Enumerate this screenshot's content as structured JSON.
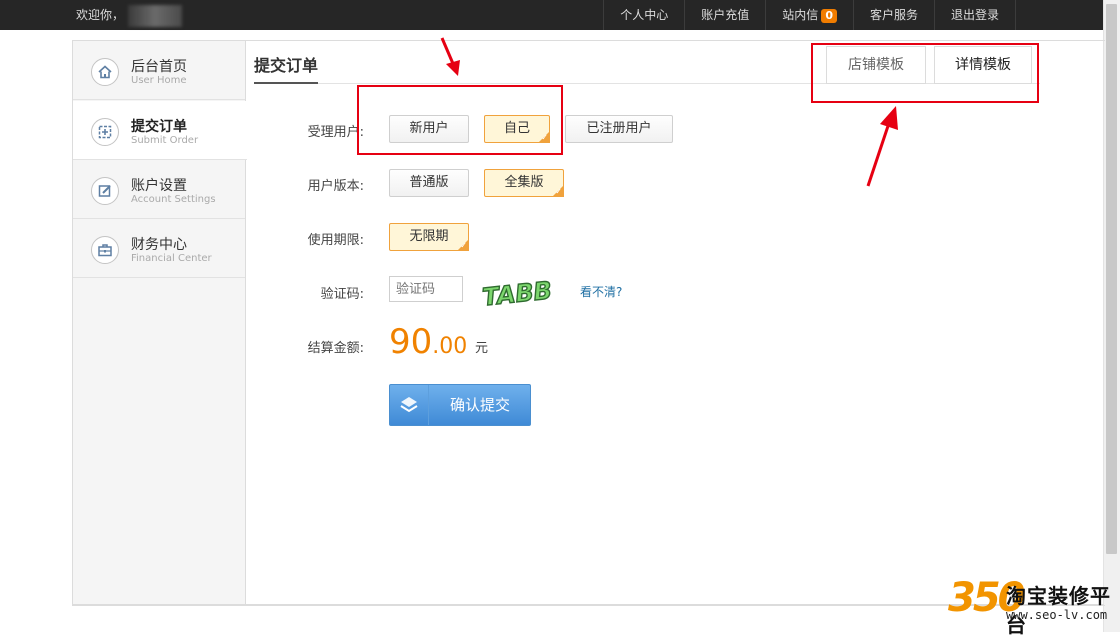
{
  "topbar": {
    "welcome": "欢迎你，",
    "nav": [
      "个人中心",
      "账户充值",
      "站内信",
      "客户服务",
      "退出登录"
    ],
    "message_count": "0"
  },
  "sidebar": {
    "items": [
      {
        "title": "后台首页",
        "subtitle": "User Home",
        "icon": "home-icon"
      },
      {
        "title": "提交订单",
        "subtitle": "Submit Order",
        "icon": "submit-order-icon"
      },
      {
        "title": "账户设置",
        "subtitle": "Account Settings",
        "icon": "edit-icon"
      },
      {
        "title": "财务中心",
        "subtitle": "Financial Center",
        "icon": "briefcase-icon"
      }
    ],
    "active_index": 1
  },
  "main": {
    "title": "提交订单",
    "template_tabs": [
      "店铺模板",
      "详情模板"
    ],
    "form": {
      "user_label": "受理用户:",
      "user_options": [
        "新用户",
        "自己",
        "已注册用户"
      ],
      "user_selected": "自己",
      "version_label": "用户版本:",
      "version_options": [
        "普通版",
        "全集版"
      ],
      "version_selected": "全集版",
      "period_label": "使用期限:",
      "period_options": [
        "无限期"
      ],
      "period_selected": "无限期",
      "captcha_label": "验证码:",
      "captcha_placeholder": "验证码",
      "captcha_text": "TABB",
      "captcha_refresh": "看不清?",
      "total_label": "结算金额:",
      "total_int": "90",
      "total_dec": ".00",
      "total_unit": "元",
      "submit_label": "确认提交"
    }
  },
  "watermark": {
    "number": "350",
    "name": "淘宝装修平台",
    "url": "www.seo-lv.com"
  },
  "colors": {
    "accent_orange": "#f08200",
    "annotation_red": "#e60012",
    "submit_blue": "#4a8fd0"
  }
}
